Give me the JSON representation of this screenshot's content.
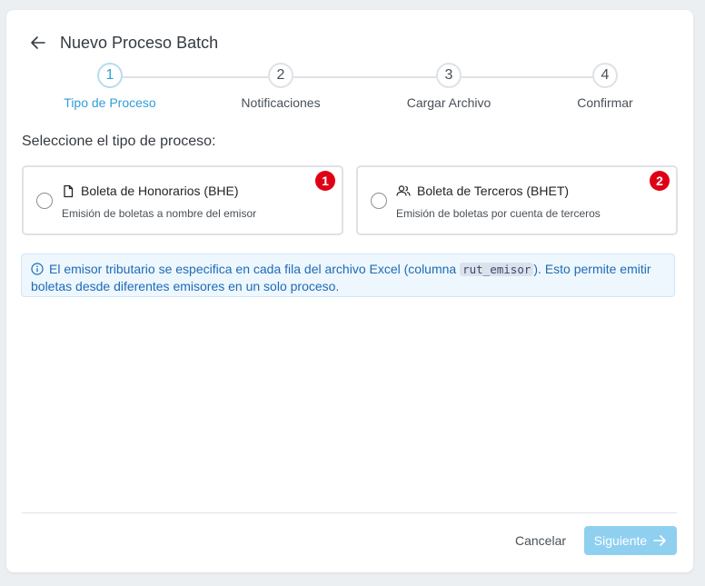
{
  "header": {
    "title": "Nuevo Proceso Batch",
    "back_icon": "arrow-left-icon"
  },
  "steps": [
    {
      "number": "1",
      "label": "Tipo de Proceso",
      "active": true
    },
    {
      "number": "2",
      "label": "Notificaciones",
      "active": false
    },
    {
      "number": "3",
      "label": "Cargar Archivo",
      "active": false
    },
    {
      "number": "4",
      "label": "Confirmar",
      "active": false
    }
  ],
  "prompt": "Seleccione el tipo de proceso:",
  "options": [
    {
      "title": "Boleta de Honorarios (BHE)",
      "description": "Emisión de boletas a nombre del emisor",
      "badge": "1",
      "icon": "file-icon",
      "selected": false
    },
    {
      "title": "Boleta de Terceros (BHET)",
      "description": "Emisión de boletas por cuenta de terceros",
      "badge": "2",
      "icon": "users-icon",
      "selected": false
    }
  ],
  "info": {
    "icon": "info-circle-icon",
    "text_before": "El emisor tributario se especifica en cada fila del archivo Excel (columna ",
    "code": "rut_emisor",
    "text_after": "). Esto permite emitir boletas desde diferentes emisores en un solo proceso."
  },
  "footer": {
    "cancel_label": "Cancelar",
    "next_label": "Siguiente",
    "next_icon": "arrow-right-icon"
  },
  "colors": {
    "accent": "#2f9fd6",
    "badge": "#e00016",
    "next_button": "#8fd0f0",
    "info_bg": "#eef7fd",
    "info_text": "#1c6bb8"
  }
}
